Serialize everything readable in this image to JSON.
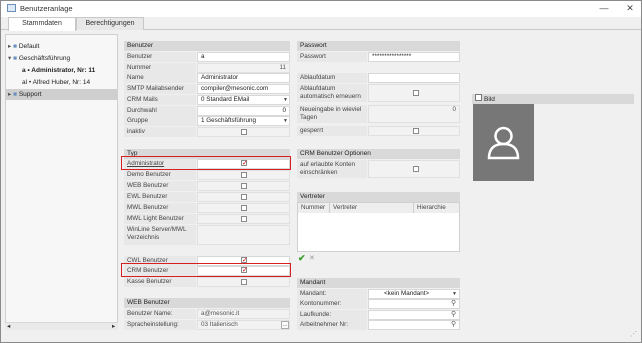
{
  "window": {
    "title": "Benutzeranlage",
    "minimize": "—",
    "close": "✕"
  },
  "tabs": [
    "Stammdaten",
    "Berechtigungen"
  ],
  "tree": {
    "items": [
      {
        "label": "Default"
      },
      {
        "label": "Geschäftsführung"
      },
      {
        "prefix": "a",
        "label": "Administrator, Nr: 11"
      },
      {
        "prefix": "al",
        "label": "Alfred Huber, Nr: 14"
      },
      {
        "label": "Support"
      }
    ]
  },
  "benutzer": {
    "header": "Benutzer",
    "rows": [
      {
        "label": "Benutzer",
        "value": "a"
      },
      {
        "label": "Nummer",
        "value": "11"
      },
      {
        "label": "Name",
        "value": "Administrator"
      },
      {
        "label": "SMTP Mailabsender",
        "value": "compiler@mesonic.com"
      },
      {
        "label": "CRM Mails",
        "value": "0 Standard EMail"
      },
      {
        "label": "Durchwahl",
        "value": "0"
      },
      {
        "label": "Gruppe",
        "value": "1 Geschäftsführung"
      },
      {
        "label": "inaktiv",
        "value": ""
      }
    ]
  },
  "typ": {
    "header": "Typ",
    "rows": [
      {
        "label": "Administrator"
      },
      {
        "label": "Demo Benutzer"
      },
      {
        "label": "WEB Benutzer"
      },
      {
        "label": "EWL Benutzer"
      },
      {
        "label": "MWL Benutzer"
      },
      {
        "label": "MWL Light Benutzer"
      },
      {
        "label": "WinLine Server/MWL Verzeichnis"
      },
      {
        "label": "CWL Benutzer"
      },
      {
        "label": "CRM Benutzer"
      },
      {
        "label": "Kasse Benutzer"
      }
    ]
  },
  "web": {
    "header": "WEB Benutzer",
    "rows": [
      {
        "label": "Benutzer Name:",
        "value": "a@mesonic.it"
      },
      {
        "label": "Spracheinstellung:",
        "value": "03 Italienisch"
      }
    ]
  },
  "passwort": {
    "header": "Passwort",
    "rows": [
      {
        "label": "Passwort",
        "value": "****************"
      },
      {
        "label": "Ablaufdatum",
        "value": ""
      },
      {
        "label": "Ablaufdatum automatisch erneuern",
        "value": ""
      },
      {
        "label": "Neueingabe in wieviel Tagen",
        "value": "0"
      },
      {
        "label": "gesperrt",
        "value": ""
      }
    ]
  },
  "crm": {
    "header": "CRM Benutzer Optionen",
    "row_label": "auf erlaubte Konten einschränken"
  },
  "vertreter": {
    "header": "Vertreter",
    "columns": [
      "Nummer",
      "Vertreter",
      "Hierarchie"
    ]
  },
  "mandant": {
    "header": "Mandant",
    "rows": [
      {
        "label": "Mandant:",
        "value": "<kein Mandant>"
      },
      {
        "label": "Kontonummer:",
        "value": ""
      },
      {
        "label": "Laufkunde:",
        "value": ""
      },
      {
        "label": "Arbeitnehmer Nr:",
        "value": ""
      }
    ]
  },
  "bild": {
    "label": "Bild"
  }
}
